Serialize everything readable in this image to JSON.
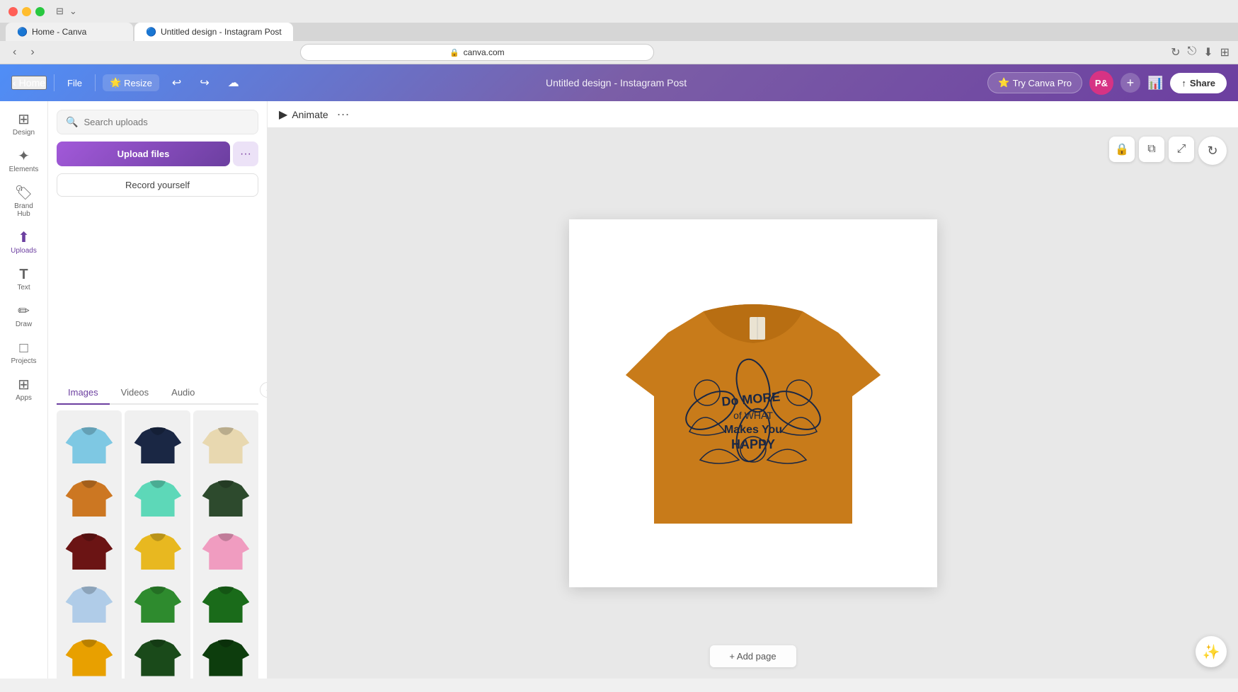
{
  "browser": {
    "url": "canva.com",
    "tabs": [
      {
        "label": "Home - Canva",
        "icon": "🔵",
        "active": false
      },
      {
        "label": "Untitled design - Instagram Post",
        "icon": "🔵",
        "active": true
      }
    ]
  },
  "topbar": {
    "home_label": "Home",
    "file_label": "File",
    "resize_label": "Resize",
    "design_title": "Untitled design - Instagram Post",
    "try_pro_label": "Try Canva Pro",
    "share_label": "Share",
    "avatar_initials": "P&"
  },
  "sidebar": {
    "items": [
      {
        "id": "design",
        "label": "Design",
        "icon": "⊞"
      },
      {
        "id": "elements",
        "label": "Elements",
        "icon": "✦"
      },
      {
        "id": "brand-hub",
        "label": "Brand Hub",
        "icon": "🏷"
      },
      {
        "id": "uploads",
        "label": "Uploads",
        "icon": "⬆"
      },
      {
        "id": "text",
        "label": "Text",
        "icon": "T"
      },
      {
        "id": "draw",
        "label": "Draw",
        "icon": "✏"
      },
      {
        "id": "projects",
        "label": "Projects",
        "icon": "□"
      },
      {
        "id": "apps",
        "label": "Apps",
        "icon": "⊞"
      }
    ]
  },
  "panel": {
    "search_placeholder": "Search uploads",
    "upload_btn_label": "Upload files",
    "record_btn_label": "Record yourself",
    "tabs": [
      {
        "id": "images",
        "label": "Images",
        "active": true
      },
      {
        "id": "videos",
        "label": "Videos",
        "active": false
      },
      {
        "id": "audio",
        "label": "Audio",
        "active": false
      }
    ],
    "tshirts": [
      {
        "color": "#7ec8e3",
        "id": "ts1"
      },
      {
        "color": "#1a2744",
        "id": "ts2"
      },
      {
        "color": "#e8d8b0",
        "id": "ts3"
      },
      {
        "color": "#cc7722",
        "id": "ts4"
      },
      {
        "color": "#5dd8b8",
        "id": "ts5"
      },
      {
        "color": "#2d4a2d",
        "id": "ts6"
      },
      {
        "color": "#6b1414",
        "id": "ts7"
      },
      {
        "color": "#e8b820",
        "id": "ts8"
      },
      {
        "color": "#f09cc0",
        "id": "ts9"
      },
      {
        "color": "#b0cce8",
        "id": "ts10"
      },
      {
        "color": "#2e8b2e",
        "id": "ts11"
      },
      {
        "color": "#1a6b1a",
        "id": "ts12"
      },
      {
        "color": "#e8a000",
        "id": "ts13"
      },
      {
        "color": "#1a4a1a",
        "id": "ts14"
      },
      {
        "color": "#0d3d0d",
        "id": "ts15"
      }
    ]
  },
  "canvas": {
    "animate_label": "Animate",
    "add_page_label": "+ Add page",
    "design_title": "Untitled design - Instagram Post"
  }
}
